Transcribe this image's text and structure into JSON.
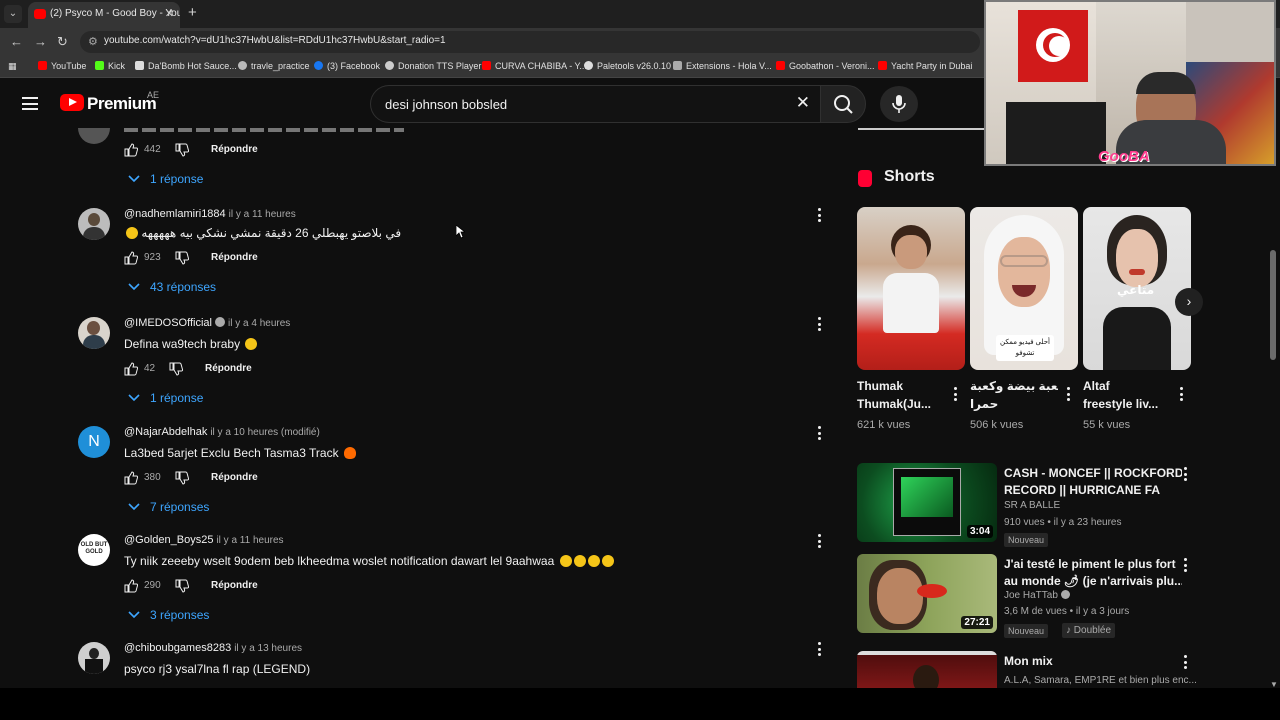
{
  "browser": {
    "tab_title": "(2) Psyco M - Good Boy - YouTub",
    "url": "youtube.com/watch?v=dU1hc37HwbU&list=RDdU1hc37HwbU&start_radio=1",
    "bookmarks": [
      "YouTube",
      "Kick",
      "Da'Bomb Hot Sauce...",
      "travle_practice",
      "(3) Facebook",
      "Donation TTS Player",
      "CURVA CHABIBA - Y...",
      "Paletools v26.0.10",
      "Extensions - Hola V...",
      "Goobathon - Veroni...",
      "Yacht Party in Dubai"
    ]
  },
  "header": {
    "brand": "Premium",
    "country": "AE",
    "search_query": "desi johnson bobsled"
  },
  "comments": {
    "top_partial": {
      "likes": "442",
      "reply_label": "Répondre",
      "replies": "1 réponse"
    },
    "items": [
      {
        "handle": "@nadhemlamiri1884",
        "time": "il y a 11 heures",
        "text": "في بلاصتو يهبطلي 26 دقيقة نمشي نشكي بيه هههههه",
        "likes": "923",
        "reply_label": "Répondre",
        "replies": "43 réponses"
      },
      {
        "handle": "@IMEDOSOfficial",
        "time": "il y a 4 heures",
        "text": "Defina wa9tech braby",
        "likes": "42",
        "reply_label": "Répondre",
        "replies": "1 réponse"
      },
      {
        "handle": "@NajarAbdelhak",
        "time": "il y a 10 heures (modifié)",
        "text": "La3bed 5arjet Exclu Bech Tasma3 Track",
        "likes": "380",
        "reply_label": "Répondre",
        "replies": "7 réponses",
        "avatar_letter": "N"
      },
      {
        "handle": "@Golden_Boys25",
        "time": "il y a 11 heures",
        "text": "Ty niik zeeeby wselt 9odem beb lkheedma woslet notification dawart lel 9aahwaa",
        "likes": "290",
        "reply_label": "Répondre",
        "replies": "3 réponses",
        "avatar_text": "OLD BUT GOLD"
      },
      {
        "handle": "@chiboubgames8283",
        "time": "il y a 13 heures",
        "text": "psyco rj3 ysal7lna fl rap (LEGEND)"
      }
    ]
  },
  "shorts": {
    "title": "Shorts",
    "items": [
      {
        "title1": "Thumak",
        "title2": "Thumak(Ju...",
        "views": "621 k vues"
      },
      {
        "title1": "كعبة بيضة وكعبة",
        "title2": "حمرا",
        "views": "506 k vues",
        "overlay": "أحلى فيديو ممكن تشوفو"
      },
      {
        "title1": "Altaf",
        "title2": "freestyle liv...",
        "views": "55 k vues",
        "overlay": "متاعي"
      }
    ]
  },
  "related": [
    {
      "title1": "CASH - MONCEF || ROCKFORD",
      "title2": "RECORD || HURRICANE FA",
      "channel": "SR A BALLE",
      "meta": "910 vues • il y a 23 heures",
      "badge": "Nouveau",
      "duration": "3:04"
    },
    {
      "title1": "J'ai testé le piment le plus fort",
      "title2": "au monde 🌶 (je n'arrivais plu...",
      "channel": "Joe HaTTab",
      "meta": "3,6 M de vues • il y a 3 jours",
      "badge": "Nouveau",
      "badge2": "Doublée",
      "duration": "27:21"
    },
    {
      "title1": "Mon mix",
      "title2": "A.L.A, Samara, EMP1RE et bien plus enc..."
    }
  ],
  "webcam": {
    "overlay_text": "GooBA"
  },
  "colors": {
    "accent": "#3ea6ff",
    "brand": "#ff0000",
    "bg": "#0f0f0f"
  }
}
